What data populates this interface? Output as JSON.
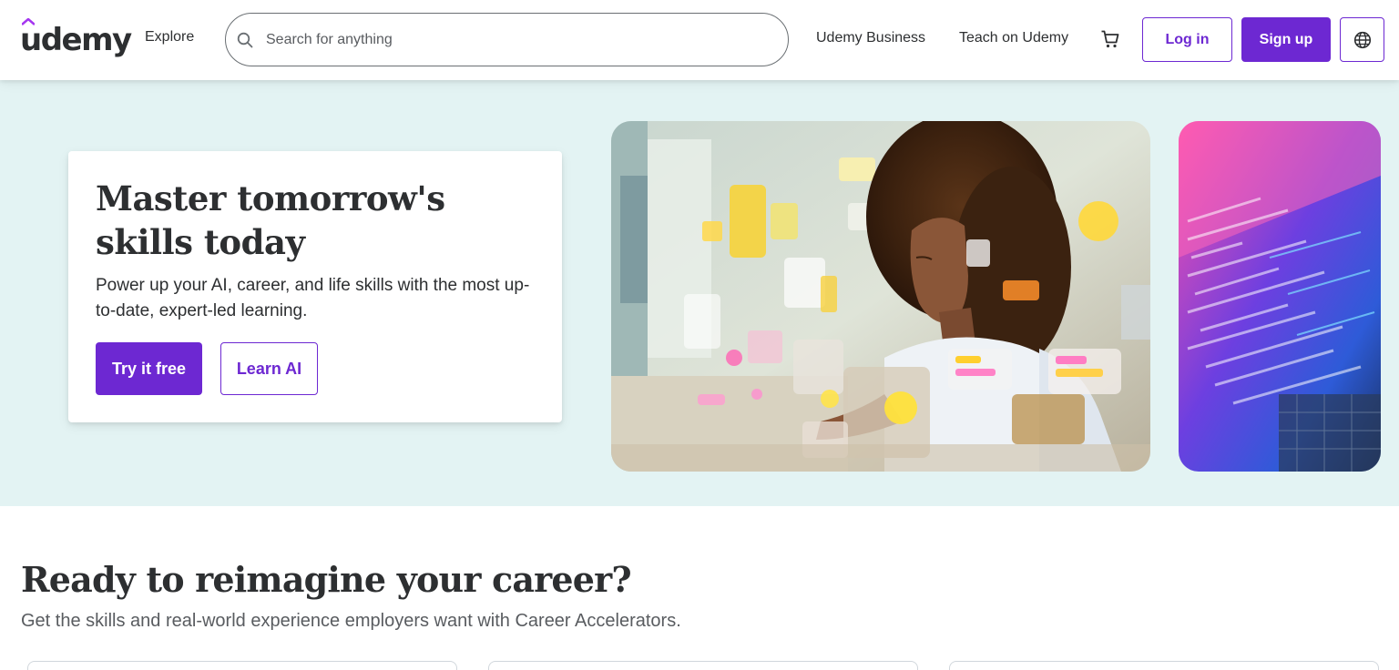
{
  "header": {
    "logo_text": "udemy",
    "explore_label": "Explore",
    "search": {
      "placeholder": "Search for anything",
      "value": ""
    },
    "links": [
      "Udemy Business",
      "Teach on Udemy"
    ],
    "login_label": "Log in",
    "signup_label": "Sign up",
    "icons": {
      "search": "search-icon",
      "cart": "cart-icon",
      "language": "globe-icon"
    }
  },
  "hero": {
    "title": "Master tomorrow's skills today",
    "subtitle": "Power up your AI, career, and life skills with the most up-to-date, expert-led learning.",
    "primary_cta": "Try it free",
    "secondary_cta": "Learn AI"
  },
  "section": {
    "title": "Ready to reimagine your career?",
    "subtitle": "Get the skills and real-world experience employers want with Career Accelerators."
  },
  "colors": {
    "brand_purple": "#6d28d2",
    "hero_background": "#e3f3f3",
    "text_dark": "#2d2f31",
    "text_muted": "#595c60"
  }
}
